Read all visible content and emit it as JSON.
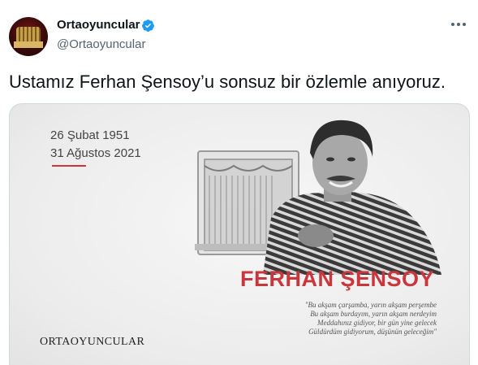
{
  "tweet": {
    "author_name": "Ortaoyuncular",
    "handle": "@Ortaoyuncular",
    "text": "Ustamız Ferhan Şensoy’u sonsuz bir özlemle anıyoruz."
  },
  "image": {
    "date_birth": "26 Şubat 1951",
    "date_death": "31 Ağustos 2021",
    "name": "FERHAN ŞENSOY",
    "quote_lines": [
      "\"Bu akşam çarşamba, yarın akşam perşembe",
      "Bu akşam burdayım, yarın akşam nerdeyim",
      "Meddahınız gidiyor, bir gün yine gelecek",
      "Güldürdüm gidiyorum, düşünün geleceğim\""
    ],
    "brand": "ORTAOYUNCULAR"
  },
  "icons": {
    "verified": "verified-badge-icon",
    "more": "more-options-icon"
  },
  "colors": {
    "verified": "#1d9bf0",
    "accent_red": "#c9373d",
    "text_primary": "#0f1419",
    "text_secondary": "#536471"
  }
}
